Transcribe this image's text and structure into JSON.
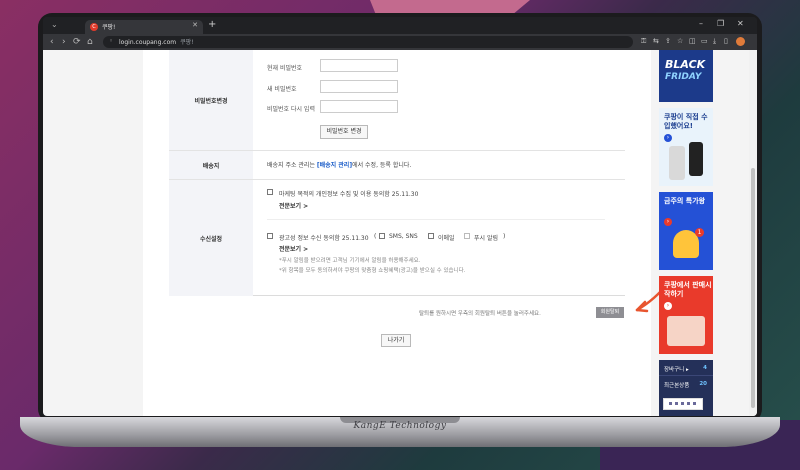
{
  "browser": {
    "tab_title": "쿠팡!",
    "tab_favicon": "C",
    "url": "login.coupang.com",
    "url_site_name": "쿠팡!",
    "window_controls": [
      "–",
      "❐",
      "✕"
    ]
  },
  "settings": {
    "password_change": {
      "header": "비밀번호변경",
      "current_label": "현재 비밀번호",
      "new_label": "새 비밀번호",
      "confirm_label": "비밀번호 다시 입력",
      "submit_label": "비밀번호 변경"
    },
    "shipping": {
      "header": "배송지",
      "text_before": "배송지 주소 관리는 ",
      "link_text": "[배송지 관리]",
      "text_after": "에서 수정, 등록 합니다."
    },
    "receive": {
      "header": "수신설정",
      "marketing_consent": "마케팅 목적의 개인정보 수집 및 이용 동의함 25.11.30",
      "view_full_1": "전문보기 >",
      "ad_consent": "광고성 정보 수신 동의함 25.11.30",
      "paren_open": "(",
      "paren_close": ")",
      "channel_sms": "SMS, SNS",
      "channel_email": "이메일",
      "channel_push": "푸시 알림",
      "view_full_2": "전문보기 >",
      "note_1": "*푸시 알림을 받으려면 고객님 기기에서 알림을 허용해주세요.",
      "note_2": "*위 항목을 모두 동의하셔야 쿠팡의 맞춤형 쇼핑혜택(광고)을 받으실 수 있습니다."
    }
  },
  "footer": {
    "withdraw_note": "탈퇴를 원하시면 우측의 회원탈퇴 버튼을 눌러주세요.",
    "withdraw_button": "회원탈퇴",
    "leave_button": "나가기"
  },
  "sidebar": {
    "ad1_line1": "BLACK",
    "ad1_line2": "FRIDAY",
    "ad2_title": "쿠팡이 직접 수입했어요!",
    "ad3_title": "금주의 특가왕",
    "ad4_title": "쿠팡에서 판매시작하기",
    "badge_count": "1",
    "cart_label": "장바구니 ▸",
    "cart_count": "4",
    "recent_label": "최근본상품",
    "recent_count": "20"
  },
  "laptop_brand": "KangE Technology",
  "colors": {
    "accent_link": "#1a5cc8",
    "coupang_red": "#e03b2b"
  }
}
